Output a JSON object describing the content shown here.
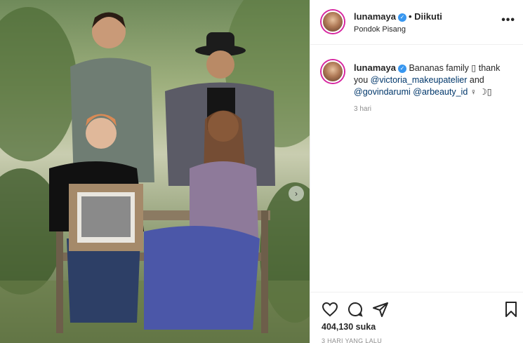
{
  "post": {
    "username": "lunamaya",
    "verified_mark": "✓",
    "follow_label": "• Diikuti",
    "location": "Pondok Pisang",
    "more_label": "•••",
    "next_arrow": "›"
  },
  "caption": {
    "username": "lunamaya",
    "text_1": "Bananas family ▯ thank you ",
    "mention_1": "@victoria_makeupatelier",
    "text_2": " and ",
    "mention_2": "@govindarumi",
    "text_3": " ",
    "mention_3": "@arbeauty_id",
    "text_4": " ♀ ☽▯",
    "time_ago": "3 hari"
  },
  "actions": {
    "likes": "404,130 suka",
    "date": "3 HARI YANG LALU"
  },
  "icons": [
    "heart-icon",
    "comment-icon",
    "share-icon",
    "bookmark-icon",
    "more-icon",
    "verified-icon",
    "chevron-right-icon"
  ],
  "colors": {
    "verified_blue": "#3897f0",
    "mention_blue": "#00376b",
    "muted_gray": "#8e8e8e",
    "text_dark": "#262626",
    "divider": "#efefef"
  }
}
